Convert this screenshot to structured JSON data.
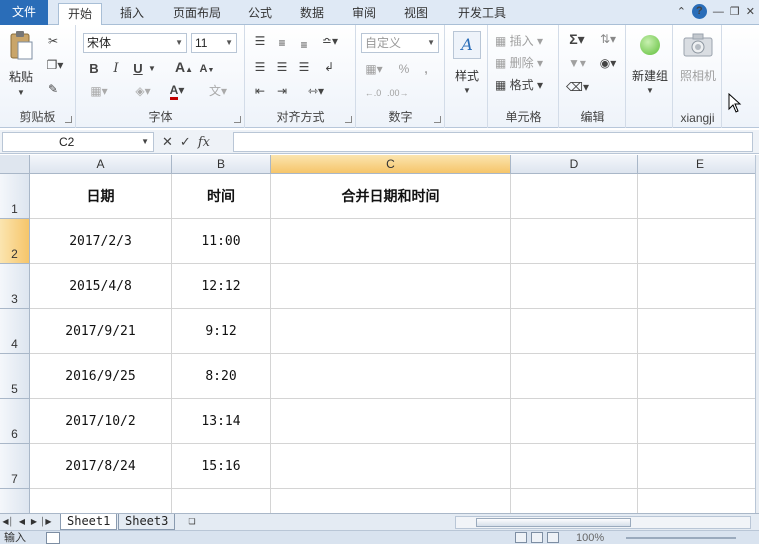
{
  "tabs": [
    {
      "label": "文件"
    },
    {
      "label": "开始"
    },
    {
      "label": "插入"
    },
    {
      "label": "页面布局"
    },
    {
      "label": "公式"
    },
    {
      "label": "数据"
    },
    {
      "label": "审阅"
    },
    {
      "label": "视图"
    },
    {
      "label": "开发工具"
    }
  ],
  "ribbon": {
    "clipboard": {
      "group": "剪贴板",
      "paste": "粘贴"
    },
    "font": {
      "group": "字体",
      "font_name": "宋体",
      "font_size": "11",
      "bold": "B",
      "italic": "I",
      "underline": "U"
    },
    "alignment": {
      "group": "对齐方式"
    },
    "number": {
      "group": "数字",
      "format": "自定义",
      "percent": "%",
      "comma": ","
    },
    "styles": {
      "group": "",
      "label": "样式"
    },
    "cells": {
      "group": "单元格",
      "insert": "插入",
      "delete": "删除",
      "format": "格式"
    },
    "editing": {
      "group": "编辑"
    },
    "newgroup": {
      "label": "新建组"
    },
    "xiangji": {
      "group": "xiangji",
      "camera": "照相机"
    }
  },
  "formula_bar": {
    "name_box": "C2",
    "fx": "fx",
    "value": ""
  },
  "columns": [
    "A",
    "B",
    "C",
    "D",
    "E"
  ],
  "rows": [
    {
      "num": "1",
      "a": "日期",
      "b": "时间",
      "c": "合并日期和时间",
      "d": "",
      "e": ""
    },
    {
      "num": "2",
      "a": "2017/2/3",
      "b": "11:00",
      "c": "",
      "d": "",
      "e": ""
    },
    {
      "num": "3",
      "a": "2015/4/8",
      "b": "12:12",
      "c": "",
      "d": "",
      "e": ""
    },
    {
      "num": "4",
      "a": "2017/9/21",
      "b": "9:12",
      "c": "",
      "d": "",
      "e": ""
    },
    {
      "num": "5",
      "a": "2016/9/25",
      "b": "8:20",
      "c": "",
      "d": "",
      "e": ""
    },
    {
      "num": "6",
      "a": "2017/10/2",
      "b": "13:14",
      "c": "",
      "d": "",
      "e": ""
    },
    {
      "num": "7",
      "a": "2017/8/24",
      "b": "15:16",
      "c": "",
      "d": "",
      "e": ""
    }
  ],
  "sheets": [
    {
      "label": "Sheet1"
    },
    {
      "label": "Sheet3"
    }
  ],
  "status": {
    "mode": "输入",
    "zoom": "100%"
  }
}
